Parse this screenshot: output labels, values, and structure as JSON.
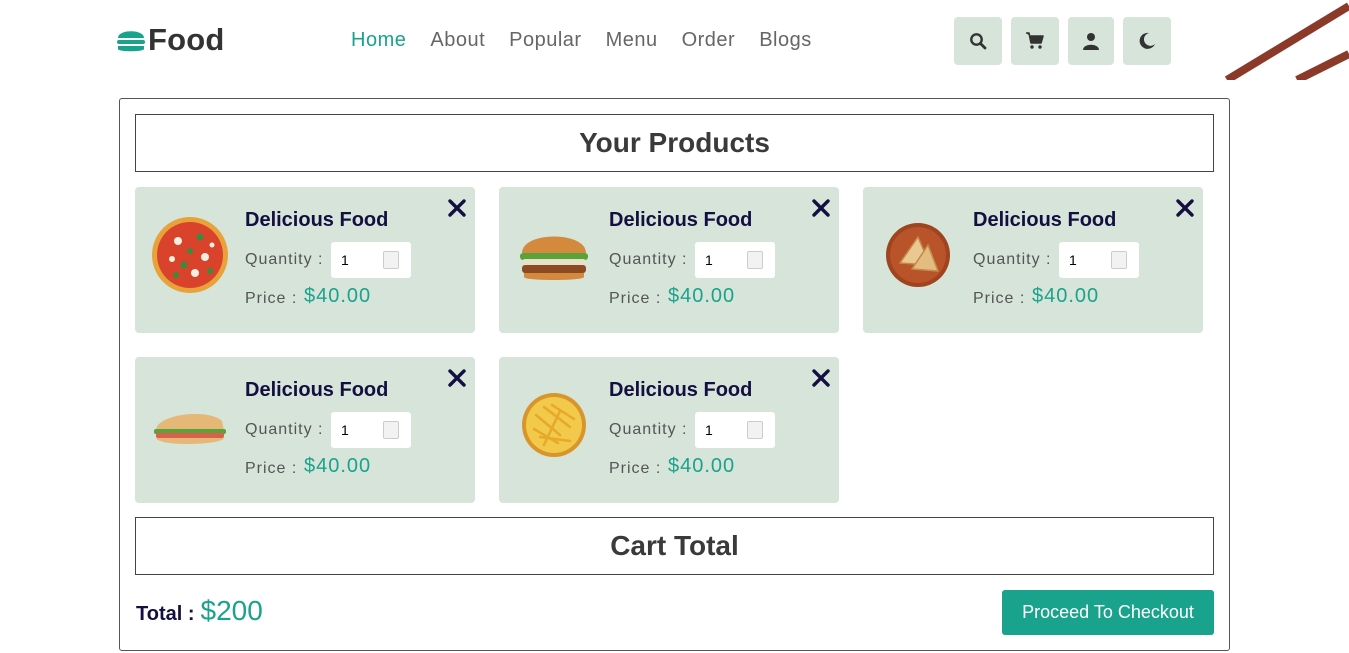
{
  "brand": {
    "name": "Food",
    "accent": "#1aa38c",
    "card_bg": "#d6e4d9",
    "dark": "#130f40"
  },
  "nav": [
    {
      "label": "Home",
      "active": true
    },
    {
      "label": "About"
    },
    {
      "label": "Popular"
    },
    {
      "label": "Menu"
    },
    {
      "label": "Order"
    },
    {
      "label": "Blogs"
    }
  ],
  "header_icons": [
    "search-icon",
    "cart-icon",
    "user-icon",
    "moon-icon"
  ],
  "cart": {
    "heading": "Your Products",
    "items": [
      {
        "name": "Delicious Food",
        "qty_label": "Quantity :",
        "qty": "1",
        "price_label": "Price :",
        "price": "$40.00",
        "image": "pizza"
      },
      {
        "name": "Delicious Food",
        "qty_label": "Quantity :",
        "qty": "1",
        "price_label": "Price :",
        "price": "$40.00",
        "image": "burger"
      },
      {
        "name": "Delicious Food",
        "qty_label": "Quantity :",
        "qty": "1",
        "price_label": "Price :",
        "price": "$40.00",
        "image": "sandwich-board"
      },
      {
        "name": "Delicious Food",
        "qty_label": "Quantity :",
        "qty": "1",
        "price_label": "Price :",
        "price": "$40.00",
        "image": "sub-sandwich"
      },
      {
        "name": "Delicious Food",
        "qty_label": "Quantity :",
        "qty": "1",
        "price_label": "Price :",
        "price": "$40.00",
        "image": "fries"
      }
    ],
    "total_heading": "Cart Total",
    "total_label": "Total :",
    "total_value": "$200",
    "checkout_label": "Proceed To Checkout"
  }
}
